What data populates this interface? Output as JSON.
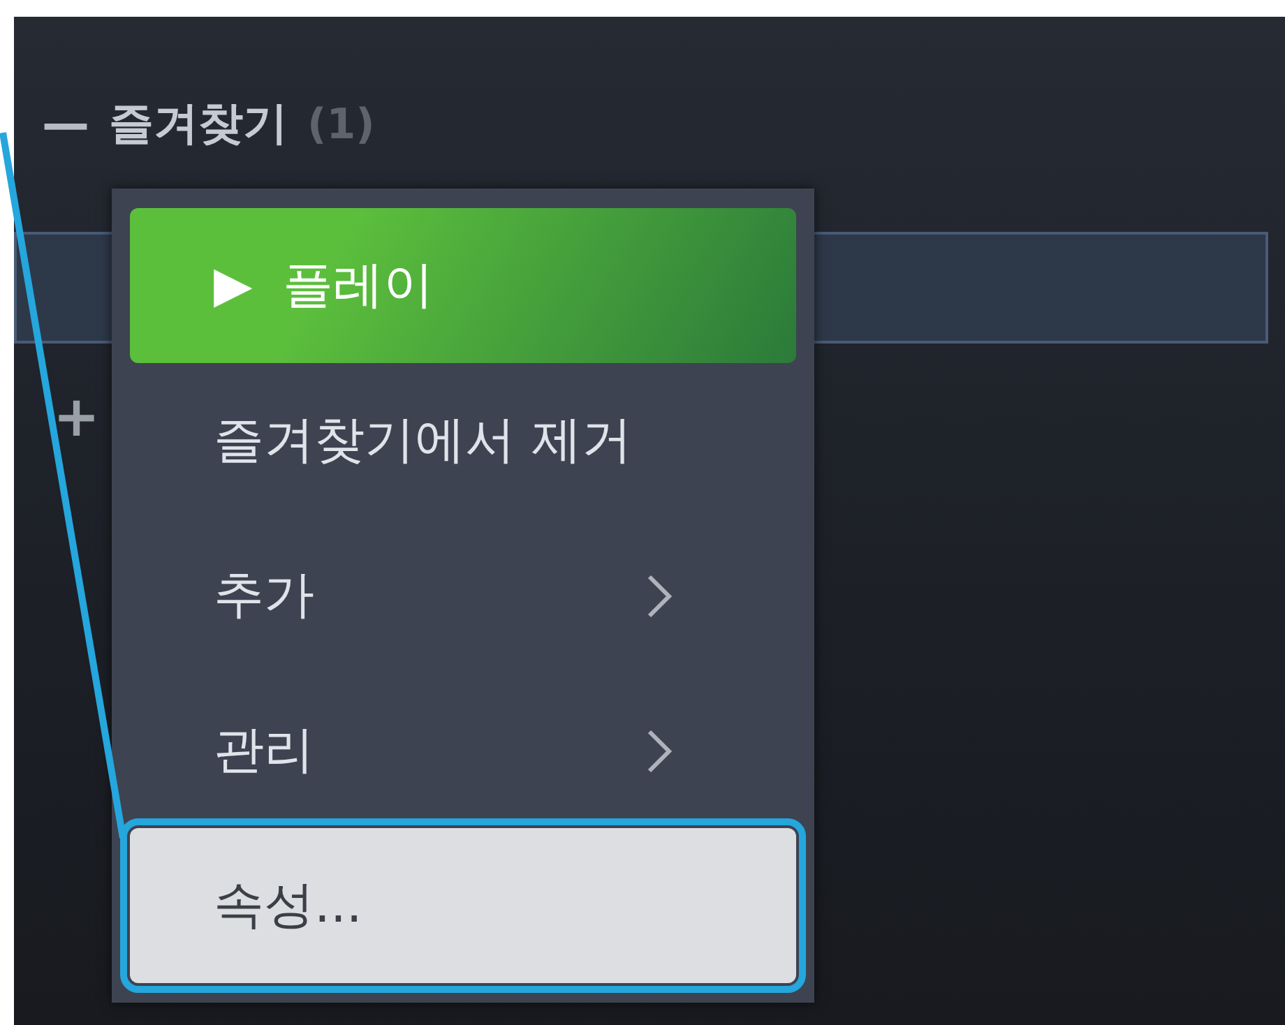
{
  "library": {
    "favorites": {
      "toggle": "—",
      "title": "즐겨찾기",
      "count": "(1)",
      "expanded": true
    },
    "next_group": {
      "toggle": "+"
    }
  },
  "context_menu": {
    "items": [
      {
        "kind": "play",
        "icon": "▶",
        "label": "플레이",
        "selected": false,
        "highlighted": false
      },
      {
        "kind": "item",
        "label": "즐겨찾기에서 제거",
        "selected": false,
        "highlighted": false
      },
      {
        "kind": "submenu",
        "label": "추가",
        "selected": false,
        "highlighted": false
      },
      {
        "kind": "submenu",
        "label": "관리",
        "selected": false,
        "highlighted": false
      },
      {
        "kind": "item",
        "label": "속성...",
        "selected": true,
        "highlighted": true
      }
    ]
  }
}
